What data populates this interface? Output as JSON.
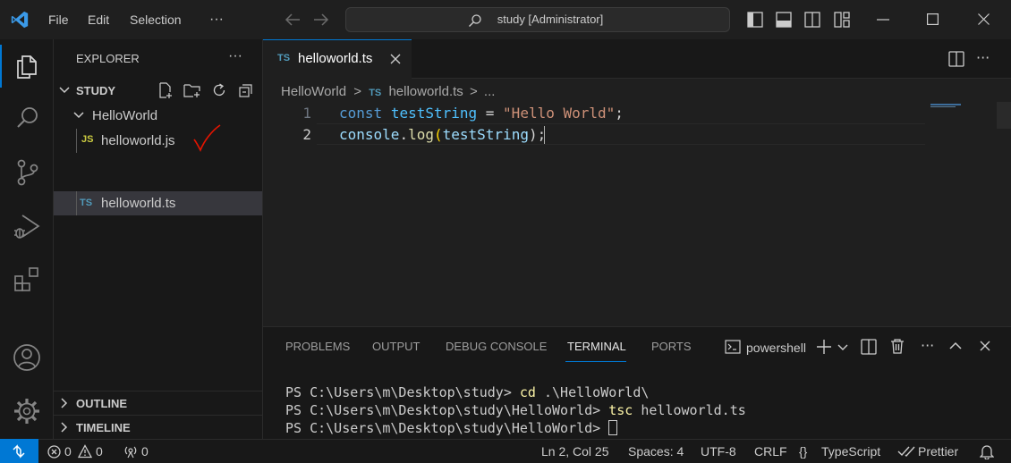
{
  "titlebar": {
    "menus": [
      "File",
      "Edit",
      "Selection"
    ],
    "more": "···",
    "search_text": "study [Administrator]"
  },
  "sidebar": {
    "header": "EXPLORER",
    "more": "···",
    "root": "STUDY",
    "folder": "HelloWorld",
    "files": [
      {
        "badge": "JS",
        "name": "helloworld.js"
      },
      {
        "badge": "TS",
        "name": "helloworld.ts"
      }
    ],
    "outline": "OUTLINE",
    "timeline": "TIMELINE"
  },
  "editor": {
    "tab": {
      "badge": "TS",
      "name": "helloworld.ts"
    },
    "breadcrumb": {
      "folder": "HelloWorld",
      "sep": ">",
      "badge": "TS",
      "file": "helloworld.ts",
      "tail": "..."
    },
    "lines": [
      {
        "num": "1",
        "tokens": [
          "const",
          " ",
          "testString",
          " = ",
          "\"Hello World\"",
          ";"
        ]
      },
      {
        "num": "2",
        "tokens": [
          "console",
          ".",
          "log",
          "(",
          "testString",
          ");"
        ]
      }
    ]
  },
  "panel": {
    "tabs": [
      "PROBLEMS",
      "OUTPUT",
      "DEBUG CONSOLE",
      "TERMINAL",
      "PORTS"
    ],
    "active_tab": "TERMINAL",
    "shell": "powershell",
    "terminal_lines": [
      {
        "prompt": "PS C:\\Users\\m\\Desktop\\study> ",
        "cmd": "cd",
        "args": " .\\HelloWorld\\"
      },
      {
        "prompt": "PS C:\\Users\\m\\Desktop\\study\\HelloWorld> ",
        "cmd": "tsc",
        "args": " helloworld.ts"
      },
      {
        "prompt": "PS C:\\Users\\m\\Desktop\\study\\HelloWorld> ",
        "cmd": "",
        "args": ""
      }
    ]
  },
  "statusbar": {
    "errors": "0",
    "warnings": "0",
    "ports": "0",
    "position": "Ln 2, Col 25",
    "spaces": "Spaces: 4",
    "encoding": "UTF-8",
    "eol": "CRLF",
    "language": "TypeScript",
    "formatter": "Prettier"
  },
  "colors": {
    "accent": "#0078d4",
    "remote": "#0078d4",
    "keyword": "#569cd6",
    "variable": "#9cdcfe",
    "string": "#ce9178",
    "function": "#dcdcaa",
    "ts_badge": "#519aba",
    "js_badge": "#cbcb41",
    "annotation": "#e51400"
  }
}
